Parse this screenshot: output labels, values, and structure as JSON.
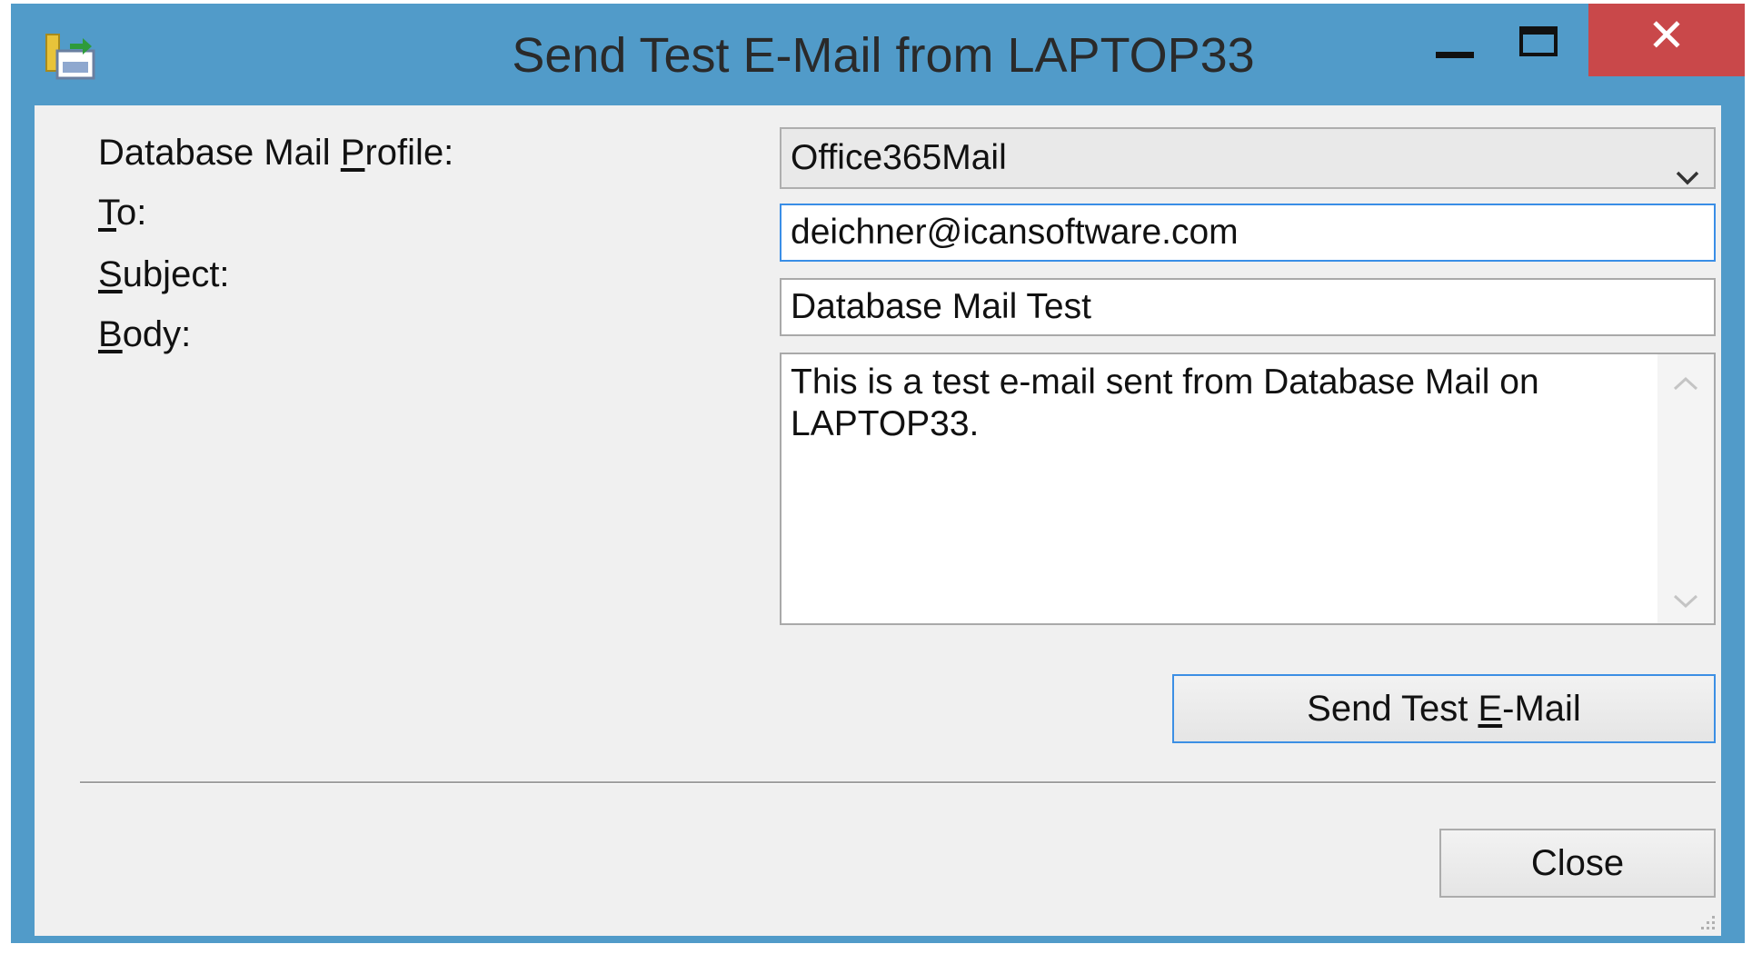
{
  "window": {
    "title": "Send Test E-Mail from LAPTOP33",
    "minimize_icon": "minimize-icon",
    "maximize_icon": "maximize-icon",
    "close_symbol": "✕",
    "close_color": "#c9484a",
    "titlebar_color": "#519bc9"
  },
  "form": {
    "profile": {
      "label_before": "Database Mail ",
      "label_mnemonic": "P",
      "label_after": "rofile:",
      "selected": "Office365Mail"
    },
    "to": {
      "label_mnemonic": "T",
      "label_after": "o:",
      "value": "deichner@icansoftware.com"
    },
    "subject": {
      "label_mnemonic": "S",
      "label_after": "ubject:",
      "value": "Database Mail Test"
    },
    "body": {
      "label_mnemonic": "B",
      "label_after": "ody:",
      "value": "This is a test e-mail sent from Database Mail on LAPTOP33."
    }
  },
  "buttons": {
    "send": {
      "before": "Send Test ",
      "mnemonic": "E",
      "after": "-Mail"
    },
    "close": "Close"
  }
}
